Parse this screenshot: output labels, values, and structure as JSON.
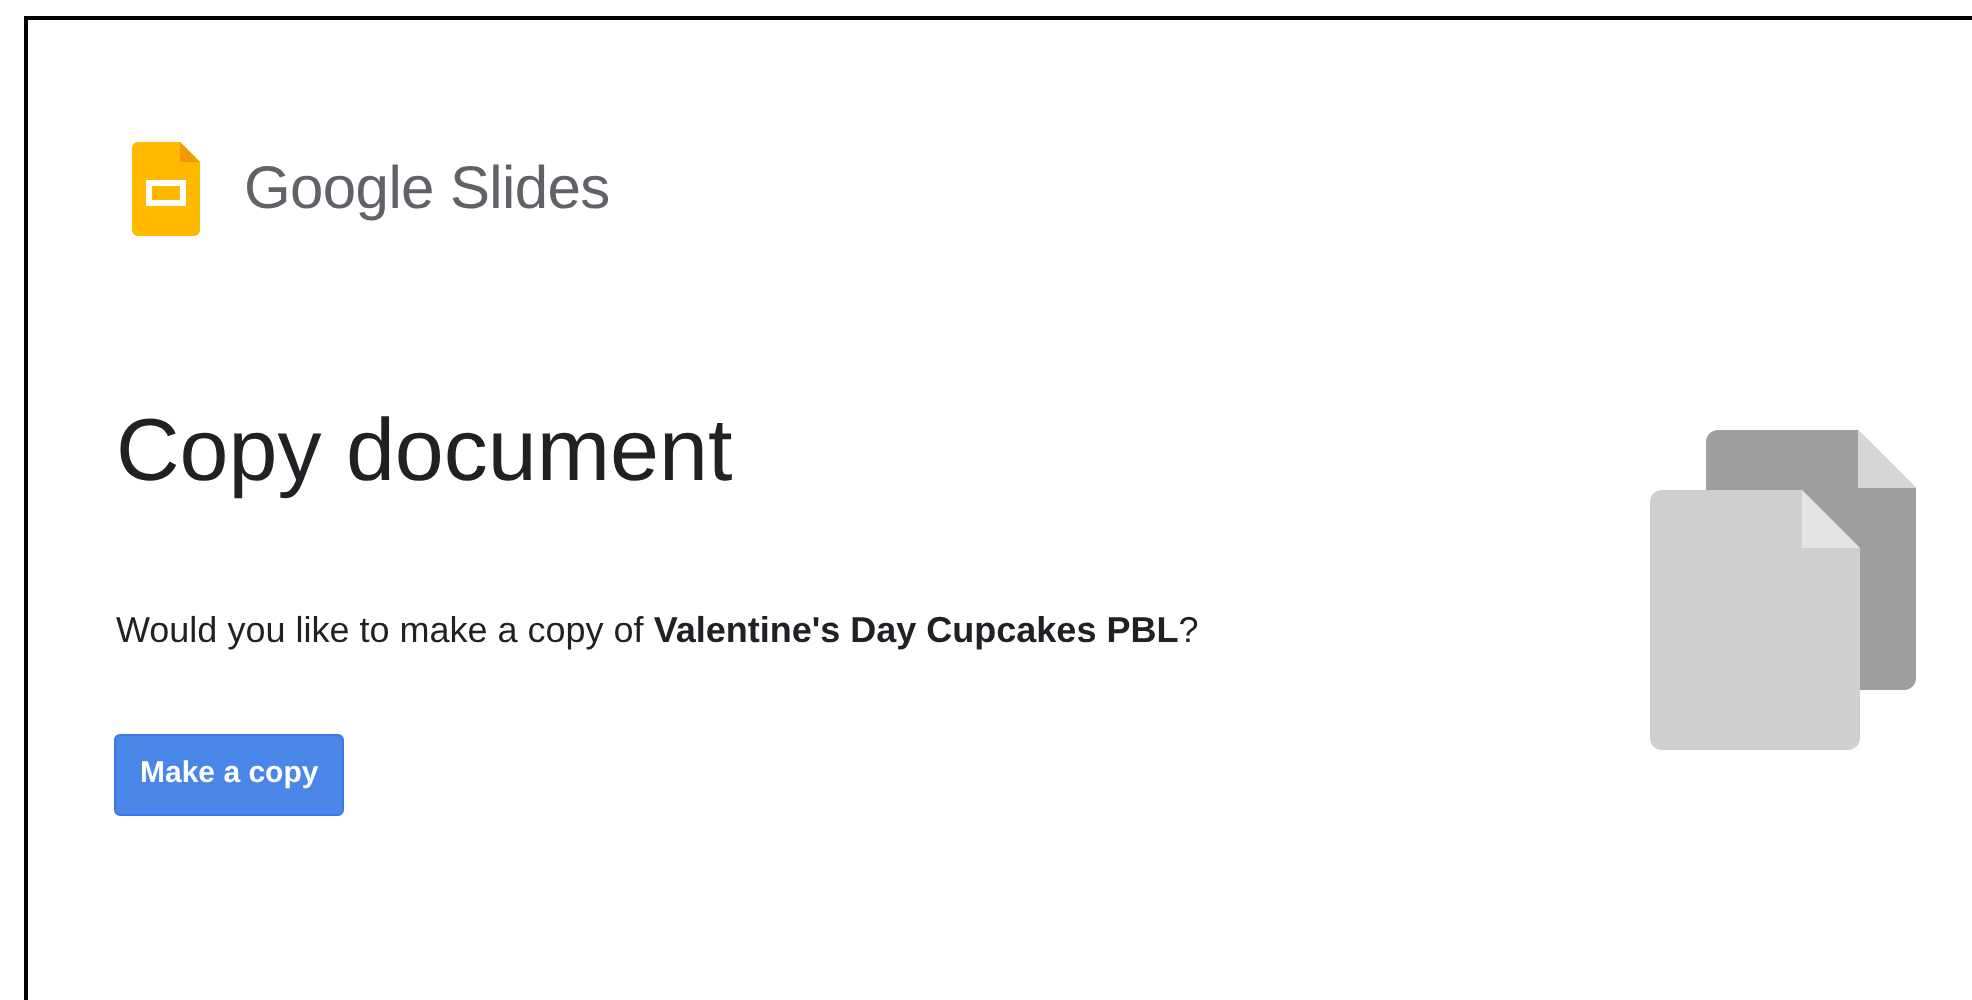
{
  "header": {
    "product": "Google Slides"
  },
  "title": "Copy document",
  "prompt": "Would you like to make a copy of **Valentine's Day Cupcakes PBL**?",
  "button": "Make a copy"
}
